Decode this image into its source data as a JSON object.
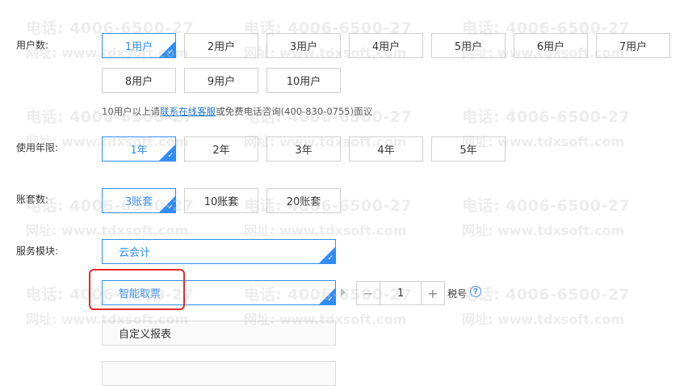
{
  "watermark": {
    "phone": "电话: 4006-6500-27",
    "site": "网址: www.tdxsoft.com"
  },
  "users": {
    "label": "用户数:",
    "options": [
      "1用户",
      "2用户",
      "3用户",
      "4用户",
      "5用户",
      "6用户",
      "7用户",
      "8用户",
      "9用户",
      "10用户"
    ],
    "selected": "1用户"
  },
  "hint": {
    "prefix": "10用户以上请",
    "link": "联系在线客服",
    "suffix": "或免费电话咨询(400-830-0755)面议"
  },
  "years": {
    "label": "使用年限:",
    "options": [
      "1年",
      "2年",
      "3年",
      "4年",
      "5年"
    ],
    "selected": "1年"
  },
  "books": {
    "label": "账套数:",
    "options": [
      "3账套",
      "10账套",
      "20账套"
    ],
    "selected": "3账套"
  },
  "modules": {
    "label": "服务模块:",
    "items": [
      "云会计",
      "智能取票",
      "自定义报表"
    ]
  },
  "stepper": {
    "minus": "−",
    "value": "1",
    "plus": "+"
  },
  "tax": {
    "label": "税号",
    "help_icon": "question-circle-icon"
  },
  "colors": {
    "accent": "#2f8df3",
    "highlight_box": "#e02a2a",
    "link": "#1a73c9"
  }
}
